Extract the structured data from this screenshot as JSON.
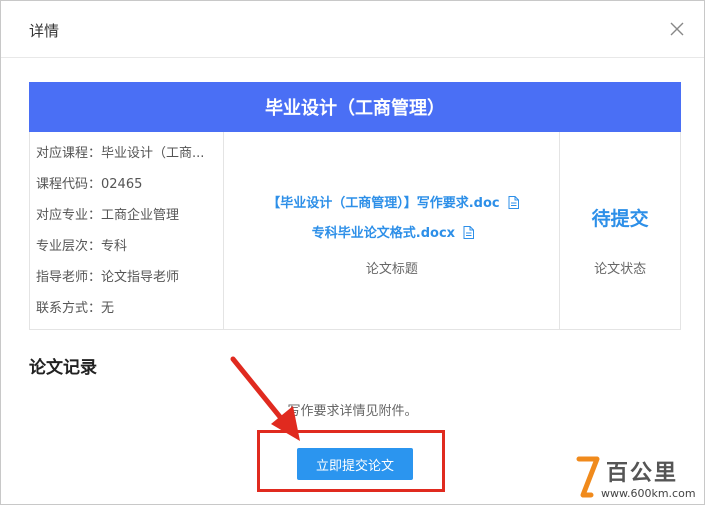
{
  "dialog": {
    "title": "详情",
    "close_label": "×"
  },
  "banner": {
    "course_title": "毕业设计（工商管理）"
  },
  "info": {
    "rows": [
      "对应课程：毕业设计（工商...",
      "课程代码：02465",
      "对应专业：工商企业管理",
      "专业层次：专科",
      "指导老师：论文指导老师",
      "联系方式：无"
    ]
  },
  "files": {
    "items": [
      "【毕业设计（工商管理）】写作要求.doc",
      "专科毕业论文格式.docx"
    ],
    "caption": "论文标题"
  },
  "status": {
    "value": "待提交",
    "caption": "论文状态"
  },
  "records": {
    "title": "论文记录",
    "note": "写作要求详情见附件。",
    "submit_label": "立即提交论文"
  },
  "watermark": {
    "brand": "百公里",
    "url": "www.600km.com"
  },
  "colors": {
    "banner": "#4a6ff5",
    "link": "#2d8fe8",
    "button": "#2b95ef",
    "highlight": "#e02a1f"
  }
}
